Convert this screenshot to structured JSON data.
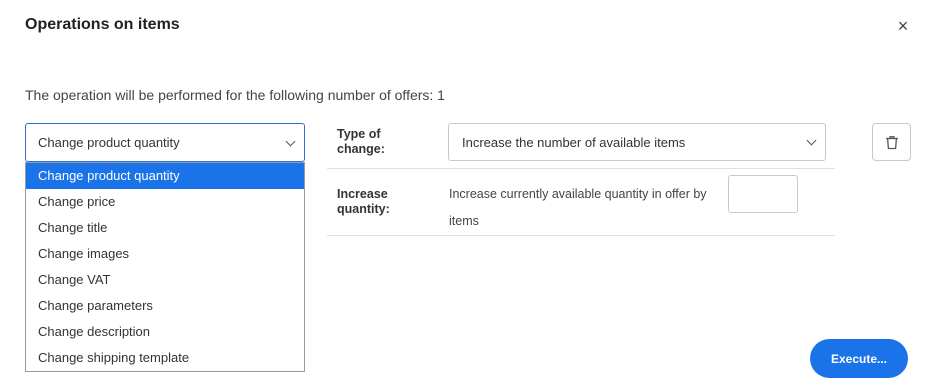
{
  "dialog": {
    "title": "Operations on items",
    "close_icon": "close-icon",
    "info_text": "The operation will be performed for the following number of offers: 1"
  },
  "operation_select": {
    "selected": "Change product quantity",
    "options": [
      "Change product quantity",
      "Change price",
      "Change title",
      "Change images",
      "Change VAT",
      "Change parameters",
      "Change description",
      "Change shipping template"
    ]
  },
  "form": {
    "type_label": "Type of change:",
    "type_value": "Increase the number of available items",
    "increase_label": "Increase quantity:",
    "increase_text": "Increase currently available quantity in offer by",
    "increase_unit": "items",
    "quantity_value": ""
  },
  "actions": {
    "delete_icon": "trash-icon",
    "execute_label": "Execute..."
  },
  "colors": {
    "accent": "#1a73e8",
    "border": "#c9c9c9",
    "text": "#333333"
  }
}
